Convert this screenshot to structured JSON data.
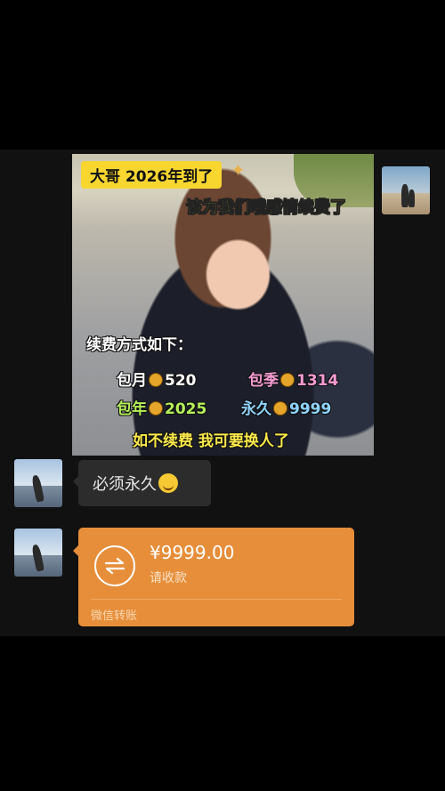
{
  "messages": {
    "image": {
      "tag_top": "大哥 2026年到了",
      "line2": "该为我们哦感情续费了",
      "methods_title": "续费方式如下：",
      "plans": [
        {
          "label": "包月",
          "price": "520"
        },
        {
          "label": "包季",
          "price": "1314"
        },
        {
          "label": "包年",
          "price": "2025"
        },
        {
          "label": "永久",
          "price": "9999"
        }
      ],
      "closing": "如不续费 我可要换人了"
    },
    "reply_text": "必须永久",
    "transfer": {
      "amount": "¥9999.00",
      "status": "请收款",
      "footer": "微信转账",
      "accent": "#e68e3a"
    }
  }
}
